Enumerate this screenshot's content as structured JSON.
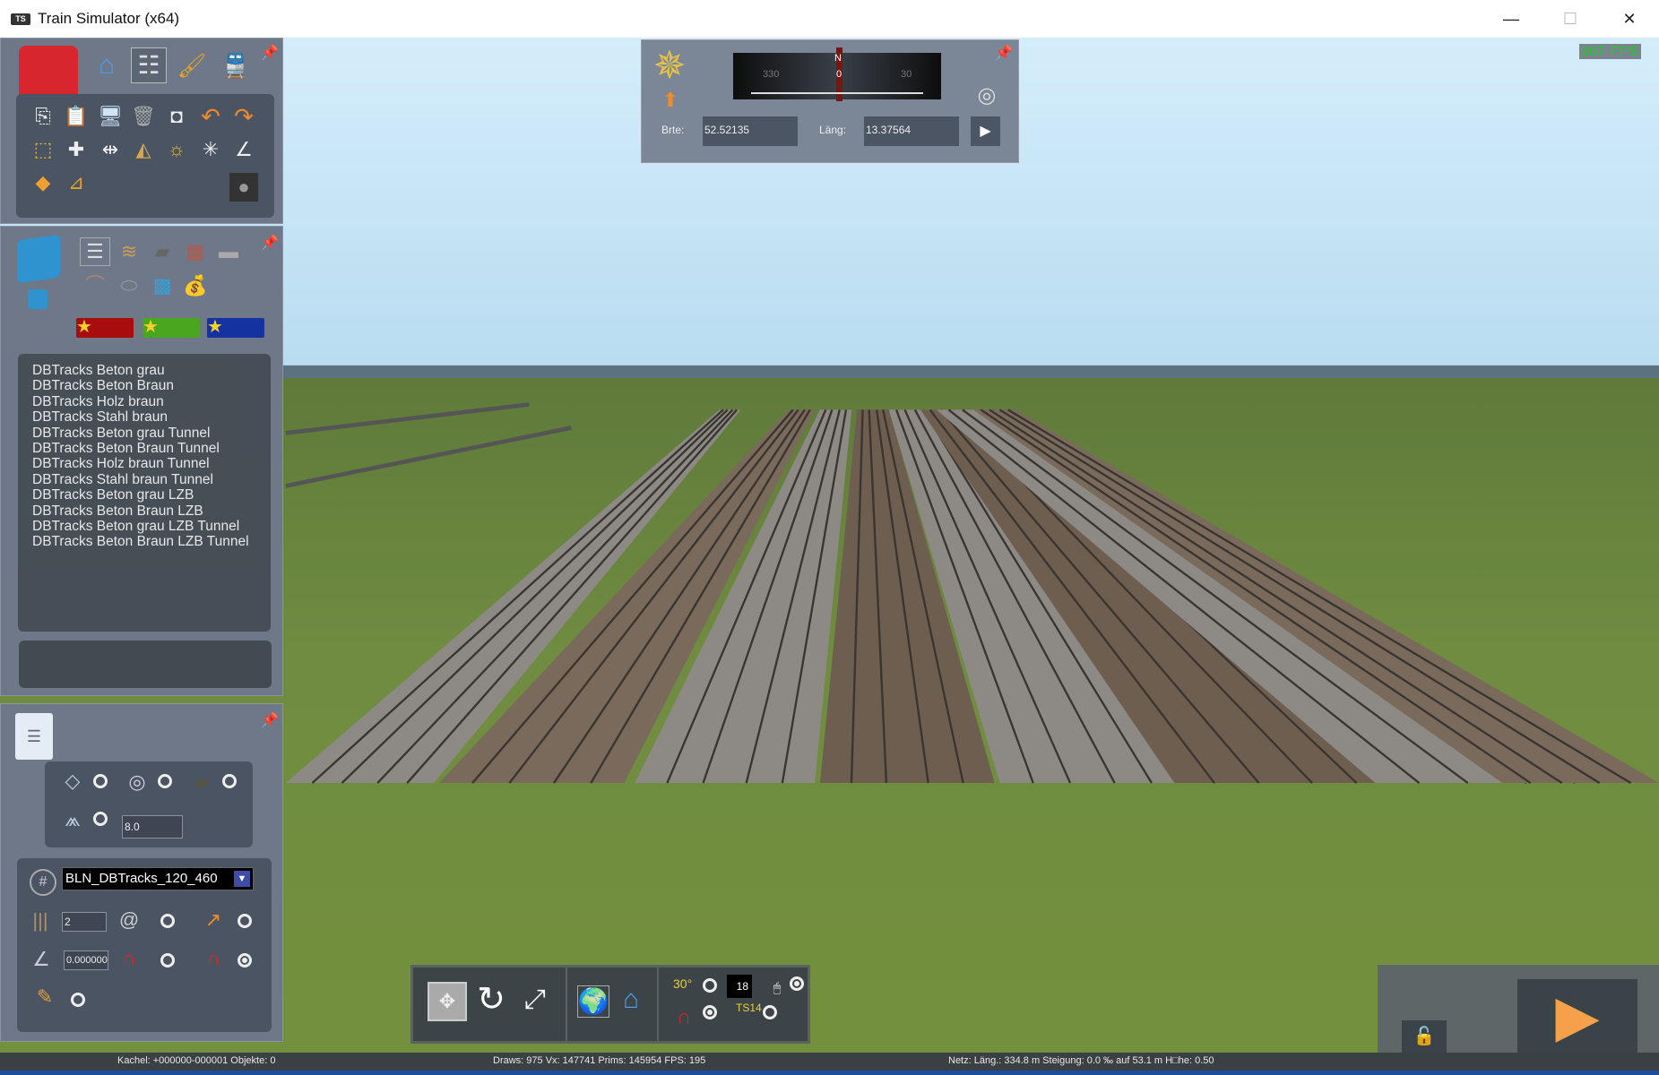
{
  "window": {
    "title": "Train Simulator (x64)",
    "app_badge": "TS",
    "minimize": "—",
    "maximize": "☐",
    "close": "✕"
  },
  "fps_overlay": "207 FPS",
  "compass": {
    "north": "N",
    "ticks": [
      "330",
      "0",
      "30"
    ],
    "lat_label": "Brte:",
    "lat_value": "52.52135",
    "lon_label": "Läng:",
    "lon_value": "13.37564"
  },
  "track_list": [
    "DBTracks Beton grau",
    "DBTracks Beton Braun",
    "DBTracks Holz braun",
    "DBTracks Stahl braun",
    "DBTracks Beton grau Tunnel",
    "DBTracks Beton Braun Tunnel",
    "DBTracks Holz braun Tunnel",
    "DBTracks Stahl braun Tunnel",
    "DBTracks Beton grau LZB",
    "DBTracks Beton Braun LZB",
    "DBTracks Beton grau LZB Tunnel",
    "DBTracks Beton Braun LZB Tunnel"
  ],
  "properties": {
    "height_value": "8.0",
    "track_rule": "BLN_DBTracks_120_460",
    "track_count": "2",
    "gradient": "0.000000"
  },
  "bottom_toolbar": {
    "counter": "18",
    "slope_label": "30°",
    "ts14_label": "TS14"
  },
  "status": {
    "left": "Kachel: +000000-000001  Objekte: 0",
    "middle": "Draws: 975 Vx: 147741 Prims: 145954 FPS: 195",
    "right": "Netz:  Läng.:  334.8 m Steigung:  0.0 ‰ auf 53.1 m H□he:   0.50"
  },
  "colors": {
    "sky": "#d6eefa",
    "grass": "#6e8a3c",
    "panel": "#6e7888",
    "fps": "#16d21a",
    "play": "#f5a04a"
  }
}
